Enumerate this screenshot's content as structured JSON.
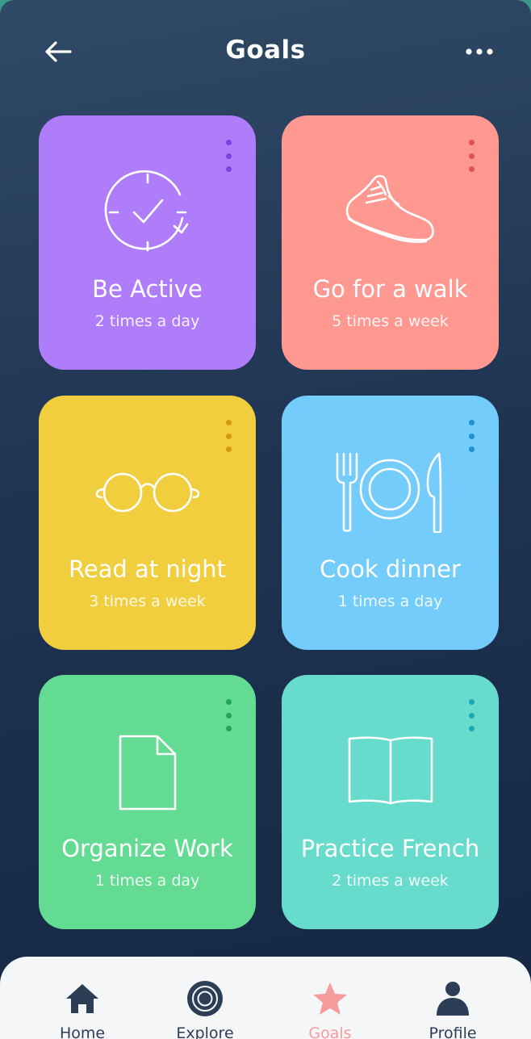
{
  "header": {
    "title": "Goals",
    "back_icon": "arrow-left-icon",
    "more_icon": "more-horizontal-icon"
  },
  "goals": [
    {
      "name": "Be Active",
      "frequency": "2 times a day",
      "icon": "clock-check-icon",
      "color": "#b07dfa",
      "dot_color": "#7c3fe0"
    },
    {
      "name": "Go for a walk",
      "frequency": "5 times a week",
      "icon": "sneaker-icon",
      "color": "#fe9891",
      "dot_color": "#e2524b"
    },
    {
      "name": "Read at night",
      "frequency": "3 times a week",
      "icon": "glasses-icon",
      "color": "#f1ce3d",
      "dot_color": "#d99a0a"
    },
    {
      "name": "Cook dinner",
      "frequency": "1 times a day",
      "icon": "fork-plate-knife-icon",
      "color": "#74ccfb",
      "dot_color": "#1a90d8"
    },
    {
      "name": "Organize Work",
      "frequency": "1 times a day",
      "icon": "document-icon",
      "color": "#64db93",
      "dot_color": "#1fa85a"
    },
    {
      "name": "Practice French",
      "frequency": "2 times a week",
      "icon": "open-book-icon",
      "color": "#68dccc",
      "dot_color": "#1aa8b5"
    }
  ],
  "nav": {
    "items": [
      {
        "label": "Home",
        "icon": "home-icon",
        "active": false
      },
      {
        "label": "Explore",
        "icon": "target-icon",
        "active": false
      },
      {
        "label": "Goals",
        "icon": "star-icon",
        "active": true
      },
      {
        "label": "Profile",
        "icon": "user-icon",
        "active": false
      }
    ],
    "active_color": "#f59b9b",
    "inactive_color": "#2c3e56"
  }
}
